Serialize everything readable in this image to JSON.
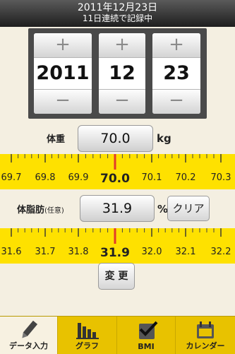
{
  "header": {
    "date": "2011年12月23日",
    "streak": "11日連続で記録中"
  },
  "date_picker": {
    "plus": "+",
    "minus": "−",
    "year": "2011",
    "month": "12",
    "day": "23"
  },
  "weight": {
    "label": "体重",
    "value": "70.0",
    "unit": "kg",
    "ruler_ticks": [
      "69.7",
      "69.8",
      "69.9",
      "70.0",
      "70.1",
      "70.2",
      "70.3"
    ],
    "selected": "70.0"
  },
  "body_fat": {
    "label": "体脂肪",
    "label_suffix": "(任意)",
    "value": "31.9",
    "unit": "%",
    "clear_label": "クリア",
    "ruler_ticks": [
      "31.6",
      "31.7",
      "31.8",
      "31.9",
      "32.0",
      "32.1",
      "32.2"
    ],
    "selected": "31.9"
  },
  "change_button": "変 更",
  "tabs": [
    {
      "label": "データ入力",
      "icon": "pencil-icon",
      "active": true
    },
    {
      "label": "グラフ",
      "icon": "bar-chart-icon",
      "active": false
    },
    {
      "label": "BMI",
      "icon": "checkmark-icon",
      "active": false
    },
    {
      "label": "カレンダー",
      "icon": "calendar-icon",
      "active": false
    }
  ],
  "colors": {
    "ruler_bg": "#fee100",
    "pointer": "#e23a2a",
    "tabbar_bg": "#e8c200",
    "page_bg": "#f4efe1"
  }
}
